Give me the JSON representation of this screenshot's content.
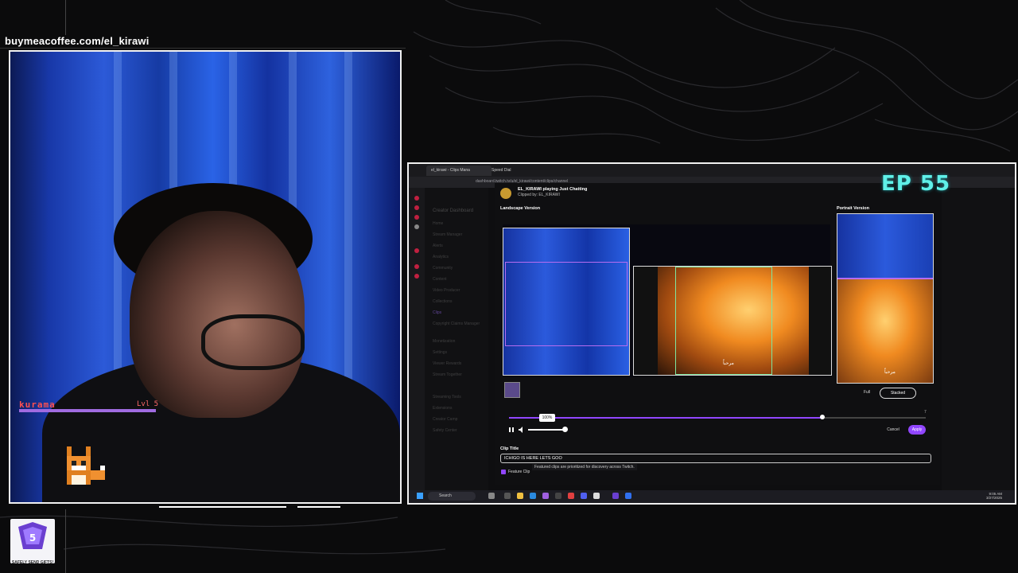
{
  "overlay": {
    "coffee_link": "buymeacoffee.com/el_kirawi",
    "pet_name": "kurama",
    "pet_level": "Lvl 5",
    "pet_health_fraction": 1.0,
    "badge_text": "SAFELY SEND GIFTS!",
    "episode": "EP 55"
  },
  "browser": {
    "tabs": [
      {
        "label": "el_kirawi - Clips Mana"
      },
      {
        "label": "Speed Dial"
      }
    ],
    "url": "dashboard.twitch.tv/u/el_kirawi/content/clips/channel"
  },
  "dashboard": {
    "sidebar_title": "Creator Dashboard",
    "items": [
      "Home",
      "Stream Manager",
      "Alerts",
      "Analytics",
      "Community",
      "Content",
      "Video Producer",
      "Collections",
      "Clips",
      "Copyright Claims Manager",
      "Monetization",
      "Settings",
      "Viewer Rewards",
      "Stream Together",
      "Streaming Tools",
      "Extensions",
      "Creator Camp",
      "Safety Center"
    ]
  },
  "clip_editor": {
    "clip_title_header": "EL_KIRAWI playing Just Chatting",
    "clipped_by": "Clipped by: EL_KIRAWI",
    "landscape_label": "Landscape Version",
    "portrait_label": "Portrait Version",
    "subtitle_text": "مرحباً",
    "full_label": "Full",
    "stacked_label": "Stacked",
    "volume_tooltip": "100%",
    "playhead_fraction": 0.75,
    "time_value": "7",
    "cancel_label": "Cancel",
    "apply_label": "Apply",
    "title_field_label": "Clip Title",
    "title_value": "ICHIGO IS HERE LETS GOO",
    "feature_label": "Feature Clip",
    "feature_tip": "Featured clips are prioritized for discovery across Twitch."
  },
  "taskbar": {
    "search_label": "Search",
    "time": "9:05 AM",
    "date": "3/27/2025"
  },
  "colors": {
    "accent": "#9146ff",
    "episode": "#5ff0e8",
    "pet_label": "#ff5050"
  }
}
